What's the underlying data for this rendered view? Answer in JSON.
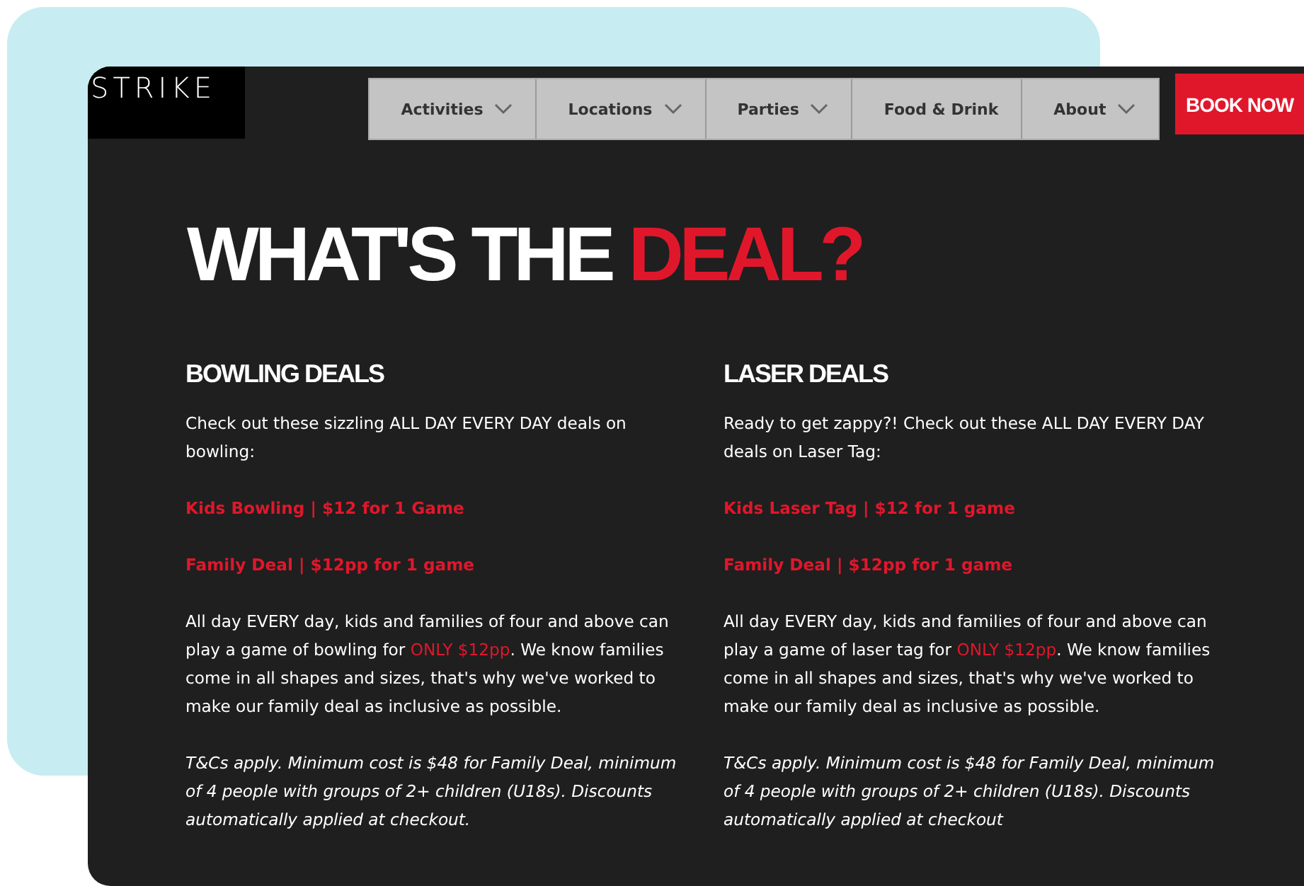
{
  "logo": "STRIKE",
  "nav": [
    {
      "label": "Activities",
      "dropdown": true
    },
    {
      "label": "Locations",
      "dropdown": true
    },
    {
      "label": "Parties",
      "dropdown": true
    },
    {
      "label": "Food & Drink",
      "dropdown": false
    },
    {
      "label": "About",
      "dropdown": true
    }
  ],
  "book_button": "BOOK NOW",
  "heading": {
    "text": "WHAT'S THE ",
    "highlight": "DEAL?"
  },
  "sections": [
    {
      "title": "BOWLING DEALS",
      "intro": "Check out these sizzling ALL DAY EVERY DAY deals on bowling:",
      "deals": [
        "Kids Bowling | $12 for 1 Game",
        "Family Deal | $12pp for 1 game"
      ],
      "body": {
        "before": "All day EVERY day, kids and families of four and above can play a game of bowling for ",
        "highlight": "ONLY $12pp",
        "after": ". We know families come in all shapes and sizes, that's why we've worked to make our family deal as inclusive as possible."
      },
      "terms": "T&Cs apply. Minimum cost is $48 for Family Deal, minimum of 4 people with groups of 2+ children (U18s). Discounts automatically applied at checkout."
    },
    {
      "title": "LASER DEALS",
      "intro": "Ready to get zappy?! Check out these ALL DAY EVERY DAY deals on Laser Tag:",
      "deals": [
        "Kids Laser Tag | $12 for 1 game",
        "Family Deal | $12pp for 1 game"
      ],
      "body": {
        "before": "All day EVERY day, kids and families of four and above can play a game of laser tag for ",
        "highlight": "ONLY $12pp",
        "after": ". We know families come in all shapes and sizes, that's why we've worked to make our family deal as inclusive as possible."
      },
      "terms": "T&Cs apply. Minimum cost is $48 for Family Deal, minimum of 4 people with groups of 2+ children (U18s). Discounts automatically applied at checkout"
    }
  ]
}
